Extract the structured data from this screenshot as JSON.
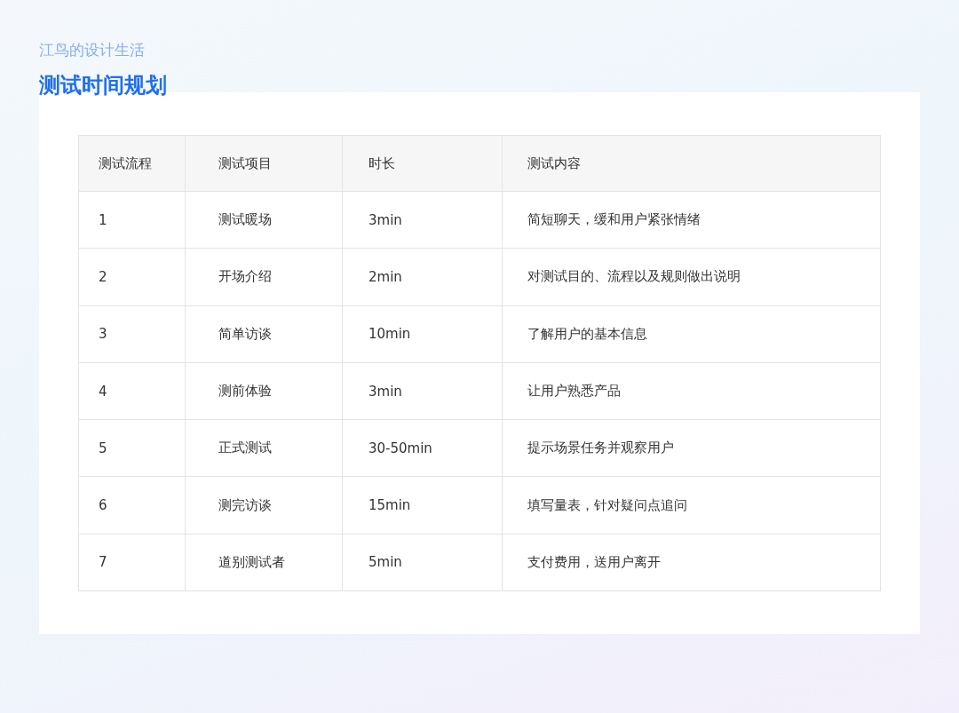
{
  "header": {
    "subtitle": "江鸟的设计生活",
    "title": "测试时间规划"
  },
  "table": {
    "columns": [
      "测试流程",
      "测试项目",
      "时长",
      "测试内容"
    ],
    "rows": [
      [
        "1",
        "测试暖场",
        "3min",
        "简短聊天，缓和用户紧张情绪"
      ],
      [
        "2",
        "开场介绍",
        "2min",
        "对测试目的、流程以及规则做出说明"
      ],
      [
        "3",
        "简单访谈",
        "10min",
        "了解用户的基本信息"
      ],
      [
        "4",
        "测前体验",
        "3min",
        "让用户熟悉产品"
      ],
      [
        "5",
        "正式测试",
        "30-50min",
        "提示场景任务并观察用户"
      ],
      [
        "6",
        "测完访谈",
        "15min",
        "填写量表，针对疑问点追问"
      ],
      [
        "7",
        "道别测试者",
        "5min",
        "支付费用，送用户离开"
      ]
    ]
  }
}
